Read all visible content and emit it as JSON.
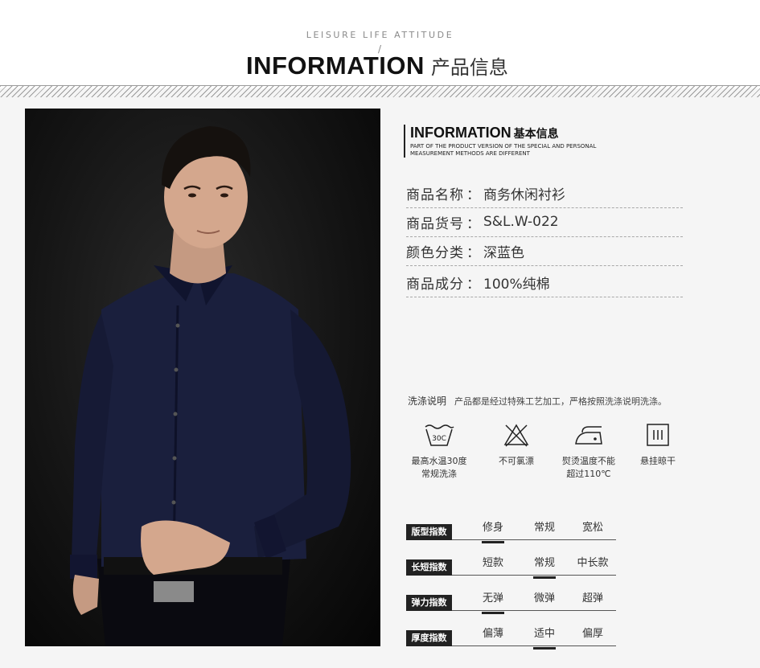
{
  "header": {
    "tagline": "LEISURE LIFE ATTITUDE",
    "slash": "/",
    "title_en": "INFORMATION",
    "title_cn": "产品信息"
  },
  "info": {
    "title_en": "INFORMATION",
    "title_cn": "基本信息",
    "subtitle": "PART OF THE PRODUCT VERSION OF THE SPECIAL AND PERSONAL MEASUREMENT METHODS ARE DIFFERENT",
    "separator": "：",
    "specs": [
      {
        "label": "商品名称",
        "value": "商务休闲衬衫"
      },
      {
        "label": "商品货号",
        "value": "S&L.W-022"
      },
      {
        "label": "颜色分类",
        "value": "深蓝色"
      },
      {
        "label": "商品成分",
        "value": "100%纯棉"
      }
    ]
  },
  "wash": {
    "title": "洗涤说明",
    "desc": "产品都是经过特殊工艺加工，严格按照洗涤说明洗涤。",
    "icon_text": "30C",
    "items": [
      {
        "icon": "wash-tub-icon",
        "line1": "最高水温30度",
        "line2": "常规洗涤"
      },
      {
        "icon": "no-bleach-icon",
        "line1": "不可氯漂",
        "line2": ""
      },
      {
        "icon": "iron-icon",
        "line1": "熨烫温度不能",
        "line2": "超过110℃"
      },
      {
        "icon": "hang-dry-icon",
        "line1": "悬挂晾干",
        "line2": ""
      }
    ]
  },
  "indices": [
    {
      "label": "版型指数",
      "options": [
        "修身",
        "常规",
        "宽松"
      ],
      "selected": 0
    },
    {
      "label": "长短指数",
      "options": [
        "短款",
        "常规",
        "中长款"
      ],
      "selected": 1
    },
    {
      "label": "弹力指数",
      "options": [
        "无弹",
        "微弹",
        "超弹"
      ],
      "selected": 0
    },
    {
      "label": "厚度指数",
      "options": [
        "偏薄",
        "适中",
        "偏厚"
      ],
      "selected": 1
    }
  ],
  "colors": {
    "shirt": "#1a1f3d",
    "background": "#f5f5f5",
    "label_bg": "#222222"
  }
}
